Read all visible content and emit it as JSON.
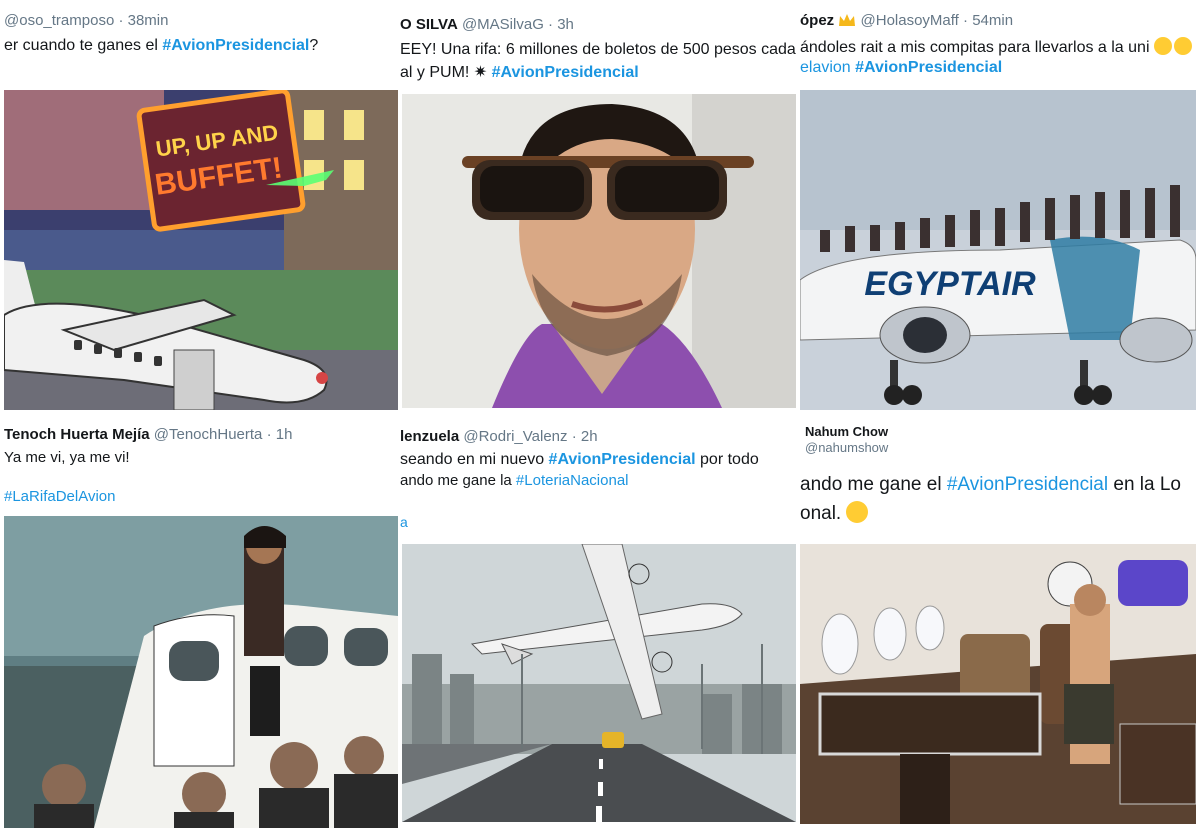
{
  "tweets": [
    {
      "name": "",
      "handle": "@oso_tramposo",
      "sep": "·",
      "time": "38min",
      "line1_pre": "er cuando te ganes el ",
      "line1_tag": "#AvionPresidencial",
      "line1_post": "?",
      "image_label": "cartoon-plane-image",
      "sign_text_1": "UP, UP AND",
      "sign_text_2": "BUFFET!"
    },
    {
      "name": "O SILVA",
      "handle": "@MASilvaG",
      "sep": "·",
      "time": "3h",
      "line1": "EEY! Una rifa: 6 millones de boletos de 500 pesos cada",
      "line2_pre": "al y PUM! ✷ ",
      "line2_tag": "#AvionPresidencial",
      "image_label": "man-sunglasses-image"
    },
    {
      "name": "ópez",
      "handle": "@HolasoyMaff",
      "sep": "·",
      "time": "54min",
      "line1": "ándoles rait a mis compitas para llevarlos a la uni",
      "line2_pre": "elavion ",
      "line2_tag": "#AvionPresidencial",
      "image_label": "egyptair-plane-image",
      "plane_text": "EGYPTAIR"
    },
    {
      "name": "Tenoch Huerta Mejía",
      "handle": "@TenochHuerta",
      "sep": "·",
      "time": "1h",
      "line1": "Ya me vi, ya me vi!",
      "line2_tag": "#LaRifaDelAvion",
      "image_label": "private-jet-photo"
    },
    {
      "name": "lenzuela",
      "handle": "@Rodri_Valenz",
      "sep": "·",
      "time": "2h",
      "line1_pre": "seando en mi nuevo ",
      "line1_tag": "#AvionPresidencial",
      "line1_post": " por todo",
      "line2_pre": "ando me gane la ",
      "line2_tag": "#LoteriaNacional",
      "line3": "a",
      "image_label": "plane-crash-highway-photo"
    },
    {
      "name": "Nahum Chow",
      "handle": "@nahumshow",
      "line1_pre": "ando me gane el ",
      "line1_tag": "#AvionPresidencial",
      "line1_post": " en la Lo",
      "line2": "onal.",
      "image_label": "plane-cabin-photo"
    }
  ],
  "colors": {
    "hashtag": "#1b95e0",
    "muted": "#657786",
    "text": "#14171a"
  }
}
